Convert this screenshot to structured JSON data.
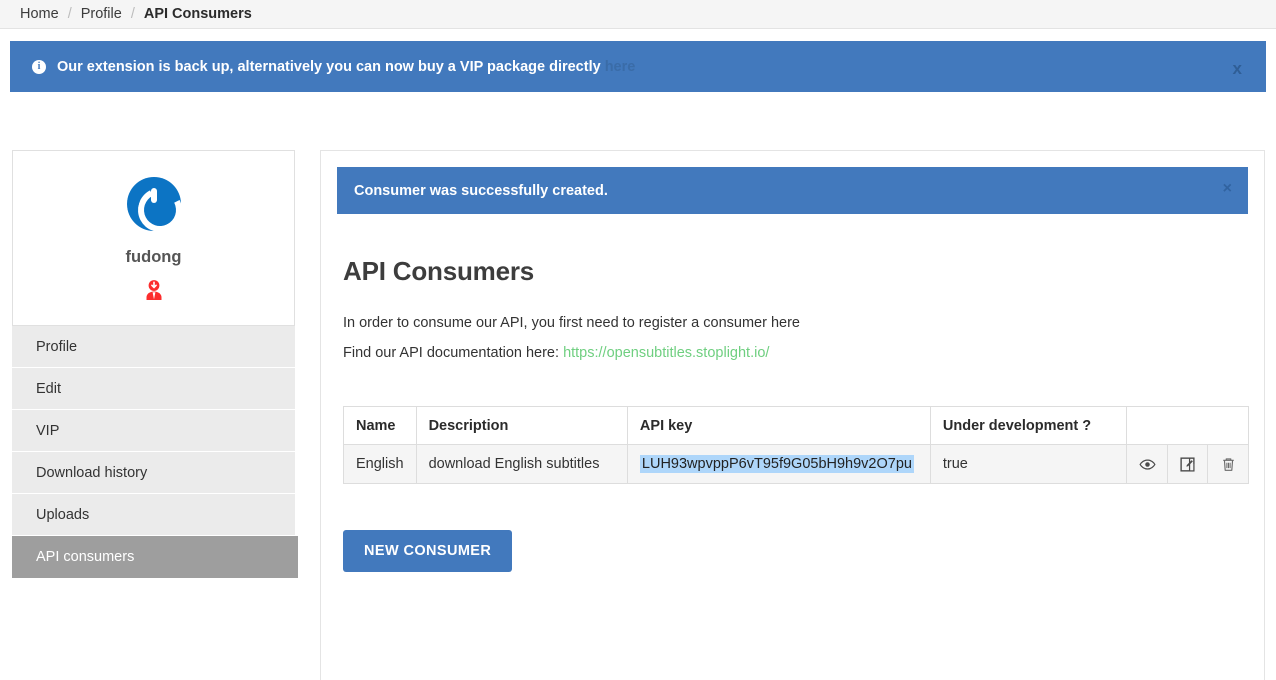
{
  "breadcrumb": {
    "items": [
      {
        "label": "Home",
        "active": false
      },
      {
        "label": "Profile",
        "active": false
      },
      {
        "label": "API Consumers",
        "active": true
      }
    ],
    "separator": "/"
  },
  "info_banner": {
    "icon": "info-circle-icon",
    "message": "Our extension is back up, alternatively you can now buy a VIP package directly",
    "link_label": "here",
    "close_label": "x",
    "background_color": "#4279bd"
  },
  "sidebar": {
    "avatar_icon": "power-logo-avatar",
    "username": "fudong",
    "rank_icon": "user-download-rank-icon",
    "rank_color": "#fc2d2d",
    "items": [
      {
        "label": "Profile",
        "active": false
      },
      {
        "label": "Edit",
        "active": false
      },
      {
        "label": "VIP",
        "active": false
      },
      {
        "label": "Download history",
        "active": false
      },
      {
        "label": "Uploads",
        "active": false
      },
      {
        "label": "API consumers",
        "active": true
      }
    ]
  },
  "main": {
    "success_alert": {
      "message": "Consumer was successfully created.",
      "close_label": "×",
      "background_color": "#4279bd"
    },
    "title": "API Consumers",
    "intro_text": "In order to consume our API, you first need to register a consumer here",
    "docs_prefix": "Find our API documentation here: ",
    "docs_link": "https://opensubtitles.stoplight.io/",
    "docs_link_color": "#6fcf80",
    "table": {
      "columns": [
        "Name",
        "Description",
        "API key",
        "Under development ?",
        ""
      ],
      "rows": [
        {
          "name": "English",
          "description": "download English subtitles",
          "api_key": "LUH93wpvppP6vT95f9G05bH9h9v2O7pu",
          "api_key_selected": true,
          "under_development": "true",
          "actions": [
            "eye-icon",
            "edit-icon",
            "trash-icon"
          ]
        }
      ],
      "selection_highlight_color": "#aed6fa"
    },
    "new_consumer_button": "NEW CONSUMER"
  }
}
